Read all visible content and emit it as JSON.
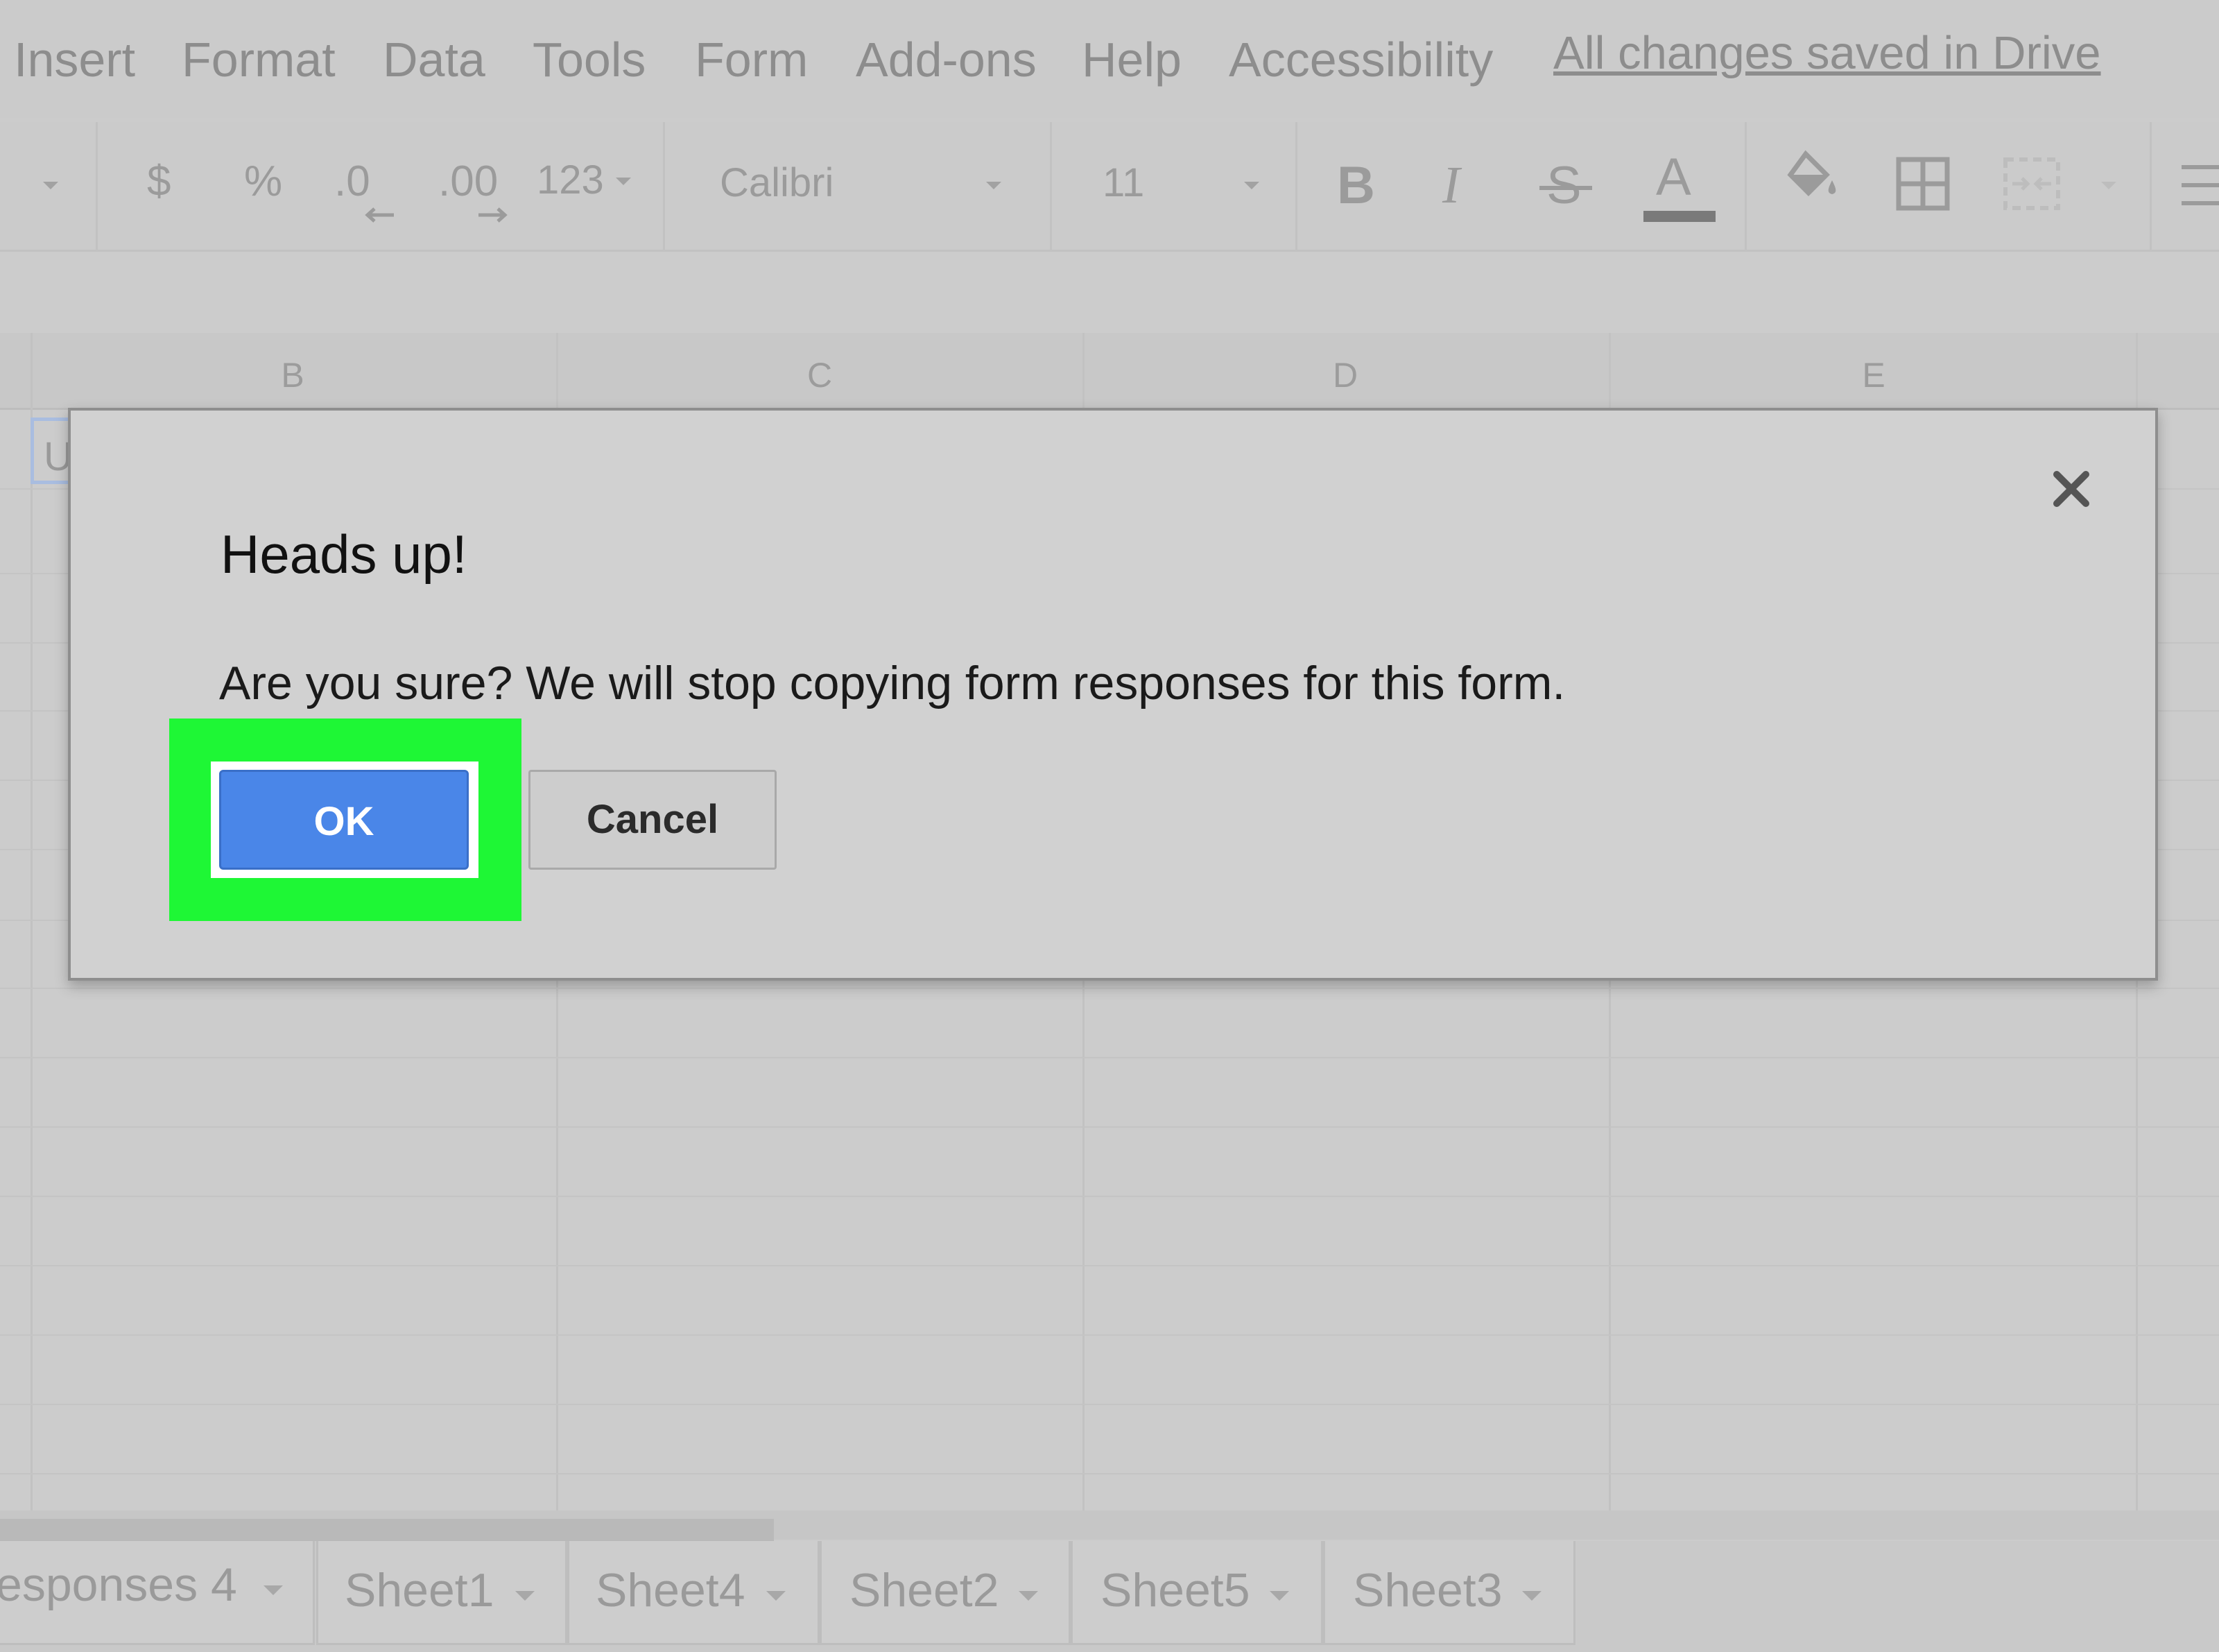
{
  "menu": {
    "items": [
      "Insert",
      "Format",
      "Data",
      "Tools",
      "Form",
      "Add-ons",
      "Help",
      "Accessibility"
    ],
    "save_status": "All changes saved in Drive"
  },
  "toolbar": {
    "currency": "$",
    "percent": "%",
    "decrease_decimal": ".0",
    "increase_decimal": ".00",
    "more_formats": "123",
    "font_family": "Calibri",
    "font_size": "11",
    "bold": "B",
    "italic": "I",
    "strikethrough": "S",
    "text_color": "A",
    "text_color_swatch": "#7a7a7a"
  },
  "grid": {
    "columns": [
      "B",
      "C",
      "D",
      "E"
    ],
    "partial_cell_text": "U"
  },
  "dialog": {
    "title": "Heads up!",
    "message": "Are you sure? We will stop copying form responses for this form.",
    "ok_label": "OK",
    "cancel_label": "Cancel",
    "highlight_color": "#1ef735",
    "ok_color": "#4a86e8"
  },
  "sheets": {
    "tabs": [
      "esponses 4",
      "Sheet1",
      "Sheet4",
      "Sheet2",
      "Sheet5",
      "Sheet3"
    ]
  }
}
